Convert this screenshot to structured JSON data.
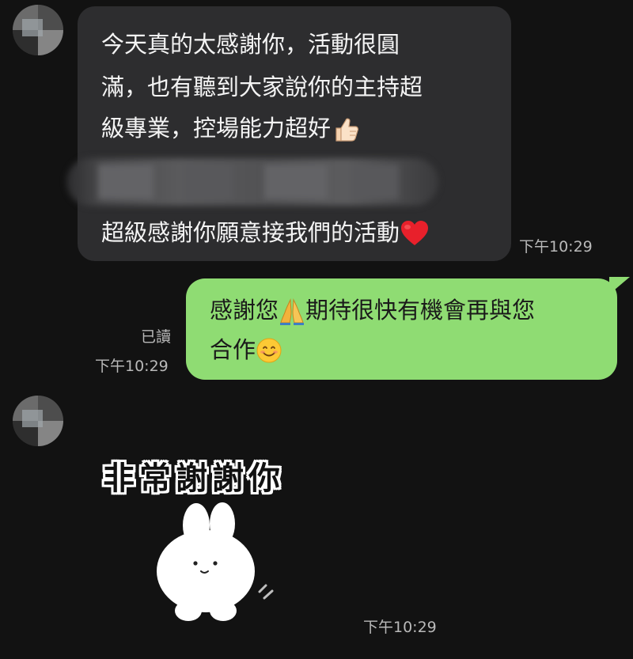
{
  "messages": [
    {
      "sender": "other",
      "lines": [
        "今天真的太感謝你，活動很圓",
        "滿，也有聽到大家說你的主持超",
        "級專業，控場能力超好"
      ],
      "closing_line": "超級感謝你願意接我們的活動",
      "emojis": [
        "thumbs-up-icon",
        "heart-icon"
      ],
      "time": "下午10:29"
    },
    {
      "sender": "me",
      "lines": [
        "感謝您",
        "期待很快有機會再與您",
        "合作"
      ],
      "emojis": [
        "pray-icon",
        "smile-icon"
      ],
      "read_label": "已讀",
      "time": "下午10:29"
    },
    {
      "sender": "other",
      "sticker_text": "非常謝謝你",
      "sticker": "white-bunny-sticker",
      "time": "下午10:29"
    }
  ],
  "colors": {
    "background": "#121212",
    "incoming_bubble": "#2d2d2f",
    "outgoing_bubble": "#8fdc73",
    "timestamp": "#b9b9b9"
  }
}
